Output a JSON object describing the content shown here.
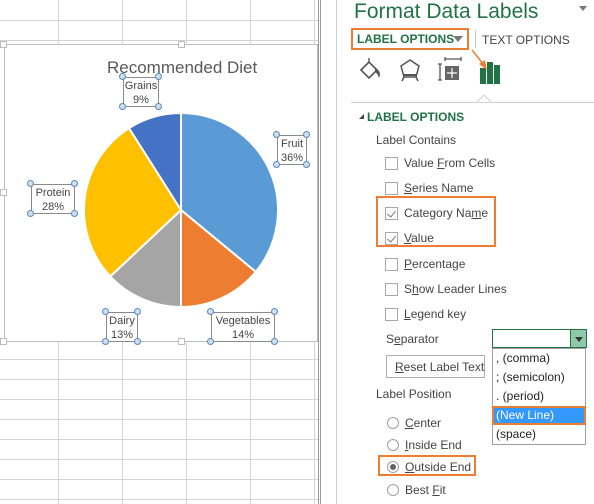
{
  "chart_data": {
    "type": "pie",
    "title": "Recommended Diet",
    "categories": [
      "Fruit",
      "Vegetables",
      "Dairy",
      "Protein",
      "Grains"
    ],
    "values": [
      36,
      14,
      13,
      28,
      9
    ],
    "value_format": "percent",
    "colors": [
      "#5b9bd5",
      "#ed7d31",
      "#a5a5a5",
      "#ffc000",
      "#4472c4"
    ],
    "start_angle_deg": 0,
    "direction": "clockwise",
    "labels": [
      {
        "category": "Fruit",
        "value_text": "36%"
      },
      {
        "category": "Vegetables",
        "value_text": "14%"
      },
      {
        "category": "Dairy",
        "value_text": "13%"
      },
      {
        "category": "Protein",
        "value_text": "28%"
      },
      {
        "category": "Grains",
        "value_text": "9%"
      }
    ],
    "label_position": "outside-end",
    "legend": "none"
  },
  "pane": {
    "title": "Format Data Labels",
    "tabs": {
      "label_options": "LABEL OPTIONS",
      "text_options": "TEXT OPTIONS"
    },
    "icon_tabs": [
      "fill-line-icon",
      "effects-icon",
      "size-properties-icon",
      "label-options-icon"
    ],
    "section_header": "LABEL OPTIONS",
    "label_contains_heading": "Label Contains",
    "checkboxes": [
      {
        "pre": "Value ",
        "u": "F",
        "post": "rom Cells",
        "checked": false
      },
      {
        "pre": "",
        "u": "S",
        "post": "eries Name",
        "checked": false
      },
      {
        "pre": "Category Na",
        "u": "m",
        "post": "e",
        "checked": true
      },
      {
        "pre": "",
        "u": "V",
        "post": "alue",
        "checked": true
      },
      {
        "pre": "",
        "u": "P",
        "post": "ercentage",
        "checked": false
      },
      {
        "pre": "S",
        "u": "h",
        "post": "ow Leader Lines",
        "checked": false
      },
      {
        "pre": "",
        "u": "L",
        "post": "egend key",
        "checked": false
      }
    ],
    "separator": {
      "label_pre": "S",
      "label_u": "e",
      "label_post": "parator",
      "value": "",
      "options": [
        ", (comma)",
        "; (semicolon)",
        ". (period)",
        "(New Line)",
        "(space)"
      ],
      "highlighted": "(New Line)"
    },
    "reset_button": {
      "u": "R",
      "post": "eset Label Text"
    },
    "label_position_heading": "Label Position",
    "radios": [
      {
        "pre": "",
        "u": "C",
        "post": "enter",
        "selected": false
      },
      {
        "pre": "",
        "u": "I",
        "post": "nside End",
        "selected": false
      },
      {
        "pre": "",
        "u": "O",
        "post": "utside End",
        "selected": true
      },
      {
        "pre": "Best ",
        "u": "F",
        "post": "it",
        "selected": false
      }
    ]
  },
  "colors": {
    "accent_green": "#217346",
    "highlight_orange": "#ed7d31",
    "selection_blue": "#3399ff"
  }
}
